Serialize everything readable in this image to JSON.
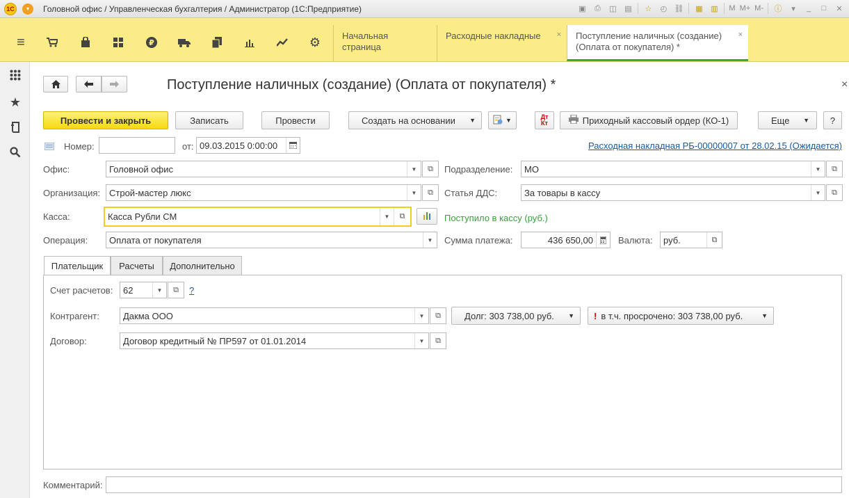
{
  "titlebar": {
    "logo": "1С",
    "title": "Головной офис / Управленческая бухгалтерия / Администратор  (1С:Предприятие)",
    "m_labels": [
      "M",
      "M+",
      "M-"
    ]
  },
  "sections": [
    {
      "icon": "menu-icon",
      "glyph": "≡"
    },
    {
      "icon": "cart-icon",
      "glyph": "🛒"
    },
    {
      "icon": "bag-icon",
      "glyph": "🛍"
    },
    {
      "icon": "grid-icon",
      "glyph": "▦"
    },
    {
      "icon": "ruble-icon",
      "glyph": "₽"
    },
    {
      "icon": "truck-icon",
      "glyph": "🚚"
    },
    {
      "icon": "copy-icon",
      "glyph": "❐"
    },
    {
      "icon": "bar-chart-icon",
      "glyph": "📊"
    },
    {
      "icon": "trend-icon",
      "glyph": "📈"
    },
    {
      "icon": "gear-icon",
      "glyph": "⚙"
    }
  ],
  "tabs": [
    {
      "label": "Начальная страница",
      "closable": false
    },
    {
      "label": "Расходные накладные",
      "closable": true
    },
    {
      "label": "Поступление наличных (создание) (Оплата от покупателя) *",
      "closable": true
    }
  ],
  "left_sidebar": [
    {
      "icon": "apps-grid-icon",
      "glyph": "⁙"
    },
    {
      "icon": "star-icon",
      "glyph": "★"
    },
    {
      "icon": "history-icon",
      "glyph": "⧉"
    },
    {
      "icon": "search-icon",
      "glyph": "🔍"
    }
  ],
  "form": {
    "title": "Поступление наличных (создание) (Оплата от покупателя) *",
    "close": "×",
    "buttons": {
      "post_close": "Провести и закрыть",
      "save": "Записать",
      "post": "Провести",
      "create_based": "Создать на основании",
      "print_ko1": "Приходный кассовый ордер (КО-1)",
      "more": "Еще",
      "help": "?"
    },
    "number_label": "Номер:",
    "number_value": "",
    "date_label": "от:",
    "date_value": "09.03.2015  0:00:00",
    "base_link": "Расходная накладная РБ-00000007 от 28.02.15 (Ожидается)",
    "office_label": "Офис:",
    "office_value": "Головной офис",
    "division_label": "Подразделение:",
    "division_value": "МО",
    "org_label": "Организация:",
    "org_value": "Строй-мастер люкс",
    "dds_label": "Статья ДДС:",
    "dds_value": "За товары в кассу",
    "kassa_label": "Касса:",
    "kassa_value": "Касса Рубли СМ",
    "received_text": "Поступило в кассу (руб.)",
    "operation_label": "Операция:",
    "operation_value": "Оплата от покупателя",
    "amount_label": "Сумма платежа:",
    "amount_value": "436 650,00",
    "currency_label": "Валюта:",
    "currency_value": "руб.",
    "tabs": [
      "Плательщик",
      "Расчеты",
      "Дополнительно"
    ],
    "account_label": "Счет расчетов:",
    "account_value": "62",
    "account_help": "?",
    "counterparty_label": "Контрагент:",
    "counterparty_value": "Дакма ООО",
    "debt_text": "Долг: 303 738,00 руб.",
    "overdue_text": "в т.ч. просрочено: 303 738,00 руб.",
    "contract_label": "Договор:",
    "contract_value": "Договор кредитный № ПР597 от 01.01.2014",
    "comment_label": "Комментарий:",
    "comment_value": ""
  }
}
